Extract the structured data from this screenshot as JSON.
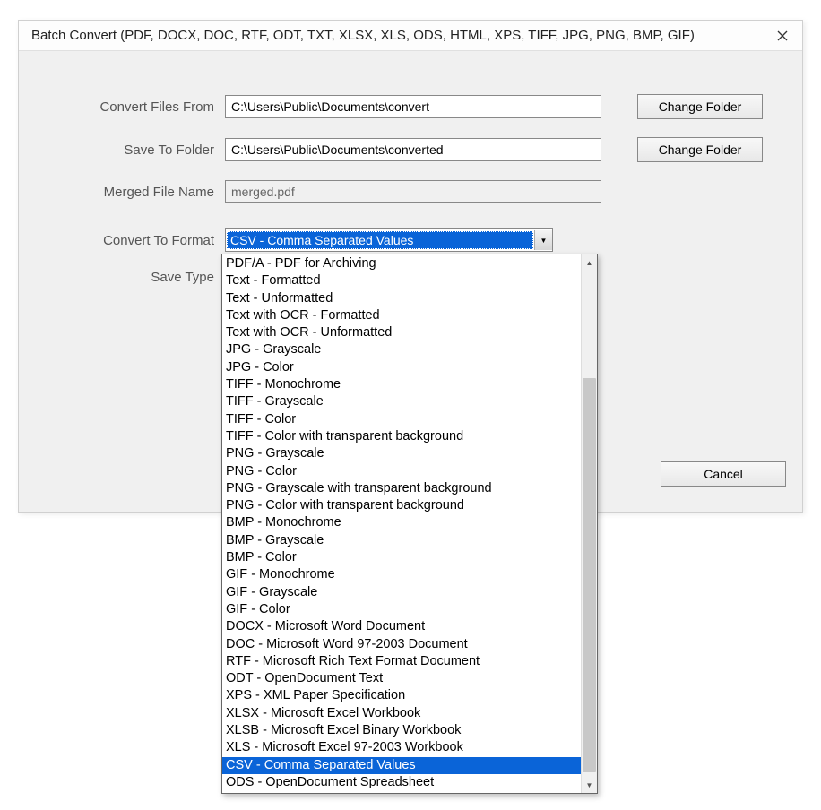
{
  "window": {
    "title": "Batch Convert (PDF, DOCX, DOC, RTF, ODT, TXT, XLSX, XLS, ODS, HTML, XPS, TIFF, JPG, PNG, BMP, GIF)"
  },
  "form": {
    "convert_from_label": "Convert Files From",
    "convert_from_value": "C:\\Users\\Public\\Documents\\convert",
    "save_to_label": "Save To Folder",
    "save_to_value": "C:\\Users\\Public\\Documents\\converted",
    "merged_name_label": "Merged File Name",
    "merged_name_value": "merged.pdf",
    "format_label": "Convert To Format",
    "format_selected": "CSV - Comma Separated Values",
    "save_type_label": "Save Type"
  },
  "buttons": {
    "change_folder": "Change Folder",
    "cancel": "Cancel"
  },
  "dropdown": {
    "selected_index": 29,
    "options": [
      "PDF/A - PDF for Archiving",
      "Text - Formatted",
      "Text - Unformatted",
      "Text with OCR - Formatted",
      "Text with OCR - Unformatted",
      "JPG - Grayscale",
      "JPG - Color",
      "TIFF - Monochrome",
      "TIFF - Grayscale",
      "TIFF - Color",
      "TIFF - Color with transparent background",
      "PNG - Grayscale",
      "PNG - Color",
      "PNG - Grayscale with transparent background",
      "PNG - Color with transparent background",
      "BMP - Monochrome",
      "BMP - Grayscale",
      "BMP - Color",
      "GIF - Monochrome",
      "GIF - Grayscale",
      "GIF - Color",
      "DOCX - Microsoft Word Document",
      "DOC - Microsoft Word 97-2003 Document",
      "RTF - Microsoft Rich Text Format Document",
      "ODT - OpenDocument Text",
      "XPS - XML Paper Specification",
      "XLSX - Microsoft Excel Workbook",
      "XLSB - Microsoft Excel Binary Workbook",
      "XLS - Microsoft Excel 97-2003 Workbook",
      "CSV - Comma Separated Values",
      "ODS - OpenDocument Spreadsheet"
    ]
  }
}
